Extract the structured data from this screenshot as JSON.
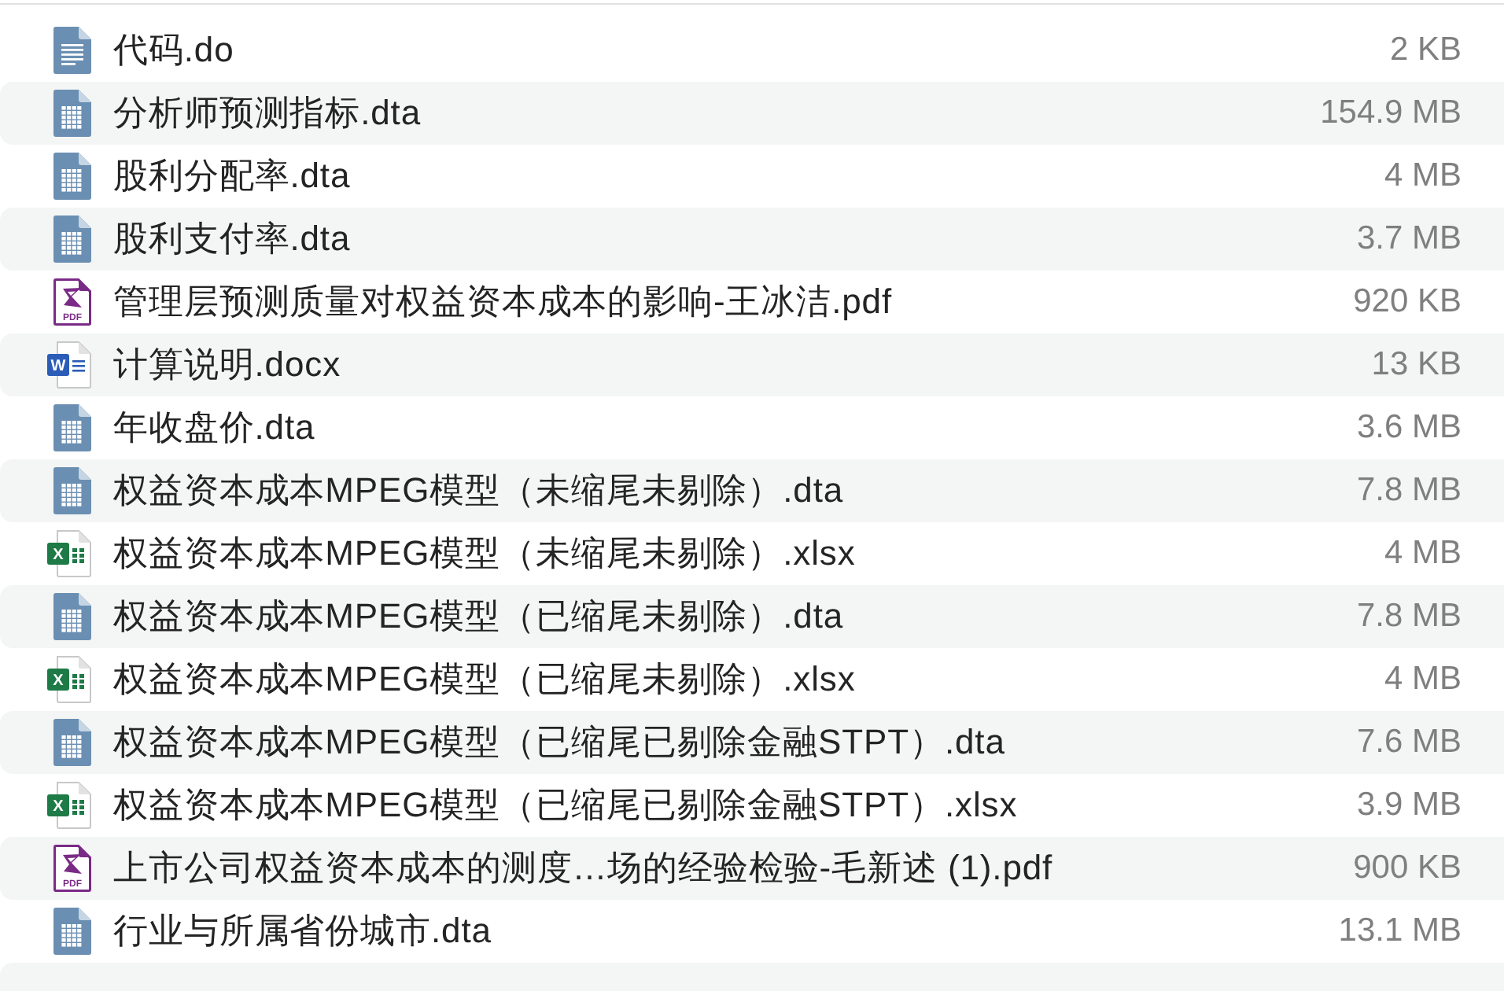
{
  "files": [
    {
      "kind": "text",
      "name": "代码.do",
      "size": "2 KB"
    },
    {
      "kind": "table",
      "name": "分析师预测指标.dta",
      "size": "154.9 MB"
    },
    {
      "kind": "table",
      "name": "股利分配率.dta",
      "size": "4 MB"
    },
    {
      "kind": "table",
      "name": "股利支付率.dta",
      "size": "3.7 MB"
    },
    {
      "kind": "pdf",
      "icon_label": "PDF",
      "name": "管理层预测质量对权益资本成本的影响-王冰洁.pdf",
      "size": "920 KB"
    },
    {
      "kind": "word",
      "icon_label": "W",
      "name": "计算说明.docx",
      "size": "13 KB"
    },
    {
      "kind": "table",
      "name": "年收盘价.dta",
      "size": "3.6 MB"
    },
    {
      "kind": "table",
      "name": "权益资本成本MPEG模型（未缩尾未剔除）.dta",
      "size": "7.8 MB"
    },
    {
      "kind": "excel",
      "icon_label": "X",
      "name": "权益资本成本MPEG模型（未缩尾未剔除）.xlsx",
      "size": "4 MB"
    },
    {
      "kind": "table",
      "name": "权益资本成本MPEG模型（已缩尾未剔除）.dta",
      "size": "7.8 MB"
    },
    {
      "kind": "excel",
      "icon_label": "X",
      "name": "权益资本成本MPEG模型（已缩尾未剔除）.xlsx",
      "size": "4 MB"
    },
    {
      "kind": "table",
      "name": "权益资本成本MPEG模型（已缩尾已剔除金融STPT）.dta",
      "size": "7.6 MB"
    },
    {
      "kind": "excel",
      "icon_label": "X",
      "name": "权益资本成本MPEG模型（已缩尾已剔除金融STPT）.xlsx",
      "size": "3.9 MB"
    },
    {
      "kind": "pdf",
      "icon_label": "PDF",
      "name": "上市公司权益资本成本的测度…场的经验检验-毛新述 (1).pdf",
      "size": "900 KB"
    },
    {
      "kind": "table",
      "name": "行业与所属省份城市.dta",
      "size": "13.1 MB"
    }
  ]
}
